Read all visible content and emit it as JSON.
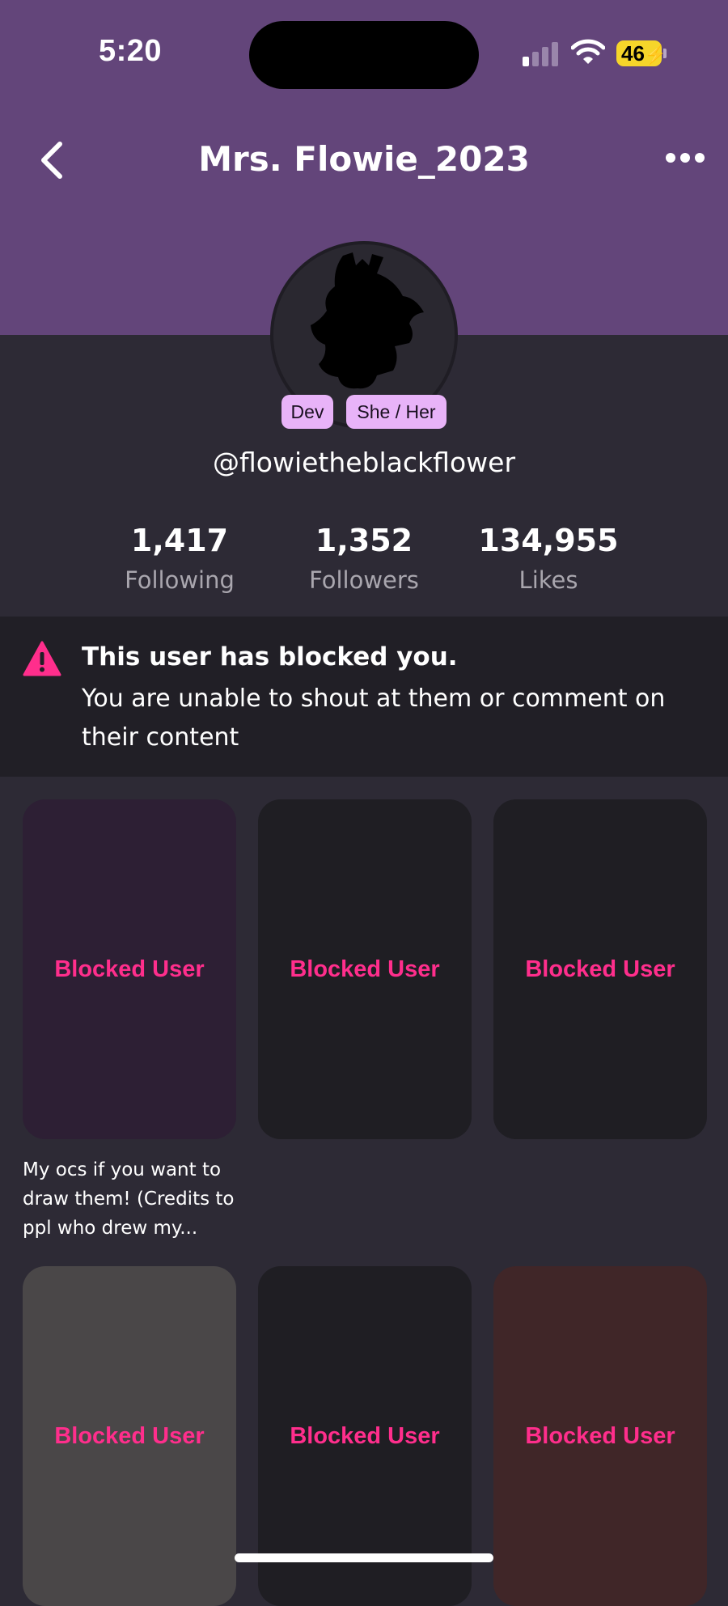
{
  "status_bar": {
    "time": "5:20",
    "battery": "46"
  },
  "header": {
    "title": "Mrs. Flowie_2023"
  },
  "profile": {
    "badges": [
      "Dev",
      "She / Her"
    ],
    "handle": "@flowietheblackflower",
    "stats": [
      {
        "value": "1,417",
        "label": "Following"
      },
      {
        "value": "1,352",
        "label": "Followers"
      },
      {
        "value": "134,955",
        "label": "Likes"
      }
    ]
  },
  "blocked_banner": {
    "title": "This user has blocked you.",
    "text": "You are unable to shout at them or comment on their content"
  },
  "posts": [
    {
      "label": "Blocked User",
      "color": "#2d1f34",
      "caption": "My ocs if you want to draw them! (Credits to ppl who drew my..."
    },
    {
      "label": "Blocked User",
      "color": "#1f1e23"
    },
    {
      "label": "Blocked User",
      "color": "#1f1e23"
    },
    {
      "label": "Blocked User",
      "color": "#4a4748"
    },
    {
      "label": "Blocked User",
      "color": "#1f1e23"
    },
    {
      "label": "Blocked User",
      "color": "#402628"
    }
  ],
  "colors": {
    "header": "#63457a",
    "accent": "#ff2e8c",
    "badge": "#e8b3f8"
  }
}
